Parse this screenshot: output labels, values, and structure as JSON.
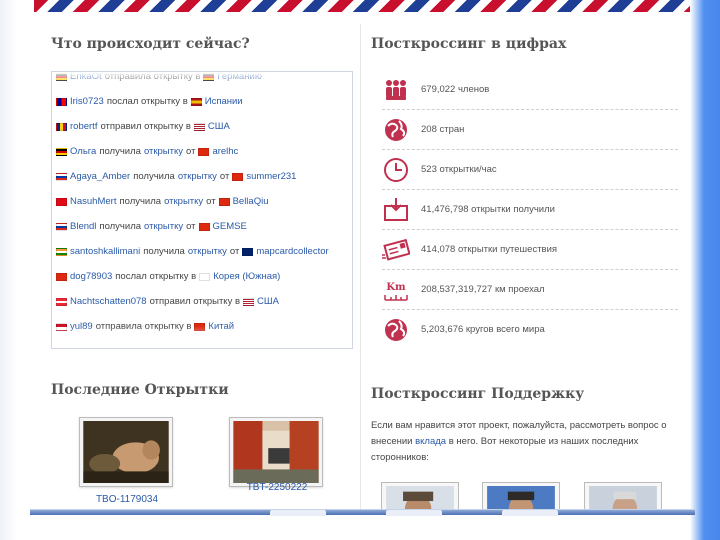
{
  "left": {
    "activity_title": "Что происходит сейчас?",
    "activity": [
      {
        "flag": "de",
        "user": "ErikaOt",
        "verb": "отправила открытку в",
        "country_flag": "de",
        "country": "Германию"
      },
      {
        "flag": "tw",
        "user": "Iris0723",
        "verb": "послал открытку в",
        "country_flag": "es",
        "country": "Испании"
      },
      {
        "flag": "ro",
        "user": "robertf",
        "verb": "отправил открытку в",
        "country_flag": "us",
        "country": "США"
      },
      {
        "flag": "de",
        "user": "Ольга",
        "verb": "получила",
        "obj": "открытку",
        "prep": "от",
        "from_flag": "hk",
        "from": "arelhc"
      },
      {
        "flag": "ru",
        "user": "Agaya_Amber",
        "verb": "получила",
        "obj": "открытку",
        "prep": "от",
        "from_flag": "hk",
        "from": "summer231"
      },
      {
        "flag": "tr",
        "user": "NasuhMert",
        "verb": "получила",
        "obj": "открытку",
        "prep": "от",
        "from_flag": "cn",
        "from": "BellaQiu"
      },
      {
        "flag": "ru",
        "user": "Blendl",
        "verb": "получила",
        "obj": "открытку",
        "prep": "от",
        "from_flag": "hk",
        "from": "GEMSE"
      },
      {
        "flag": "in",
        "user": "santoshkallimani",
        "verb": "получила",
        "obj": "открытку",
        "prep": "от",
        "from_flag": "gb",
        "from": "mapcardcollector"
      },
      {
        "flag": "cn",
        "user": "dog78903",
        "verb": "послал открытку в",
        "country_flag": "kr",
        "country": "Корея (Южная)"
      },
      {
        "flag": "at",
        "user": "Nachtschatten078",
        "verb": "отправил открытку в",
        "country_flag": "us",
        "country": "США"
      },
      {
        "flag": "id",
        "user": "yul89",
        "verb": "отправила открытку в",
        "country_flag": "cn",
        "country": "Китай"
      }
    ],
    "recent_title": "Последние Открытки",
    "recent_cards": [
      {
        "label": "TBO-1179034"
      },
      {
        "label": "TBT-2250222"
      }
    ]
  },
  "right": {
    "stats_title": "Посткроссинг в цифрах",
    "stats": [
      {
        "icon": "members-icon",
        "text": "679,022 членов"
      },
      {
        "icon": "globe-icon",
        "text": "208 стран"
      },
      {
        "icon": "clock-icon",
        "text": "523 открытки/час"
      },
      {
        "icon": "postcard-received-icon",
        "text": "41,476,798 открытки получили"
      },
      {
        "icon": "postcard-traveling-icon",
        "text": "414,078 открытки путешествия"
      },
      {
        "icon": "distance-icon",
        "text": "208,537,319,727 км проехал",
        "icon_label": "Km"
      },
      {
        "icon": "globe-icon",
        "text": "5,203,676 кругов всего мира"
      }
    ],
    "support_title": "Посткроссинг Поддержку",
    "support_text_before": "Если вам нравится этот проект, пожалуйста, рассмотреть вопрос о внесении",
    "support_link": "вклада",
    "support_text_after": "в него. Вот некоторые из наших последних сторонников:"
  },
  "colors": {
    "accent": "#c0314f",
    "link": "#2a5aa8",
    "airmail_red": "#c8102e",
    "airmail_blue": "#1f3f97"
  }
}
